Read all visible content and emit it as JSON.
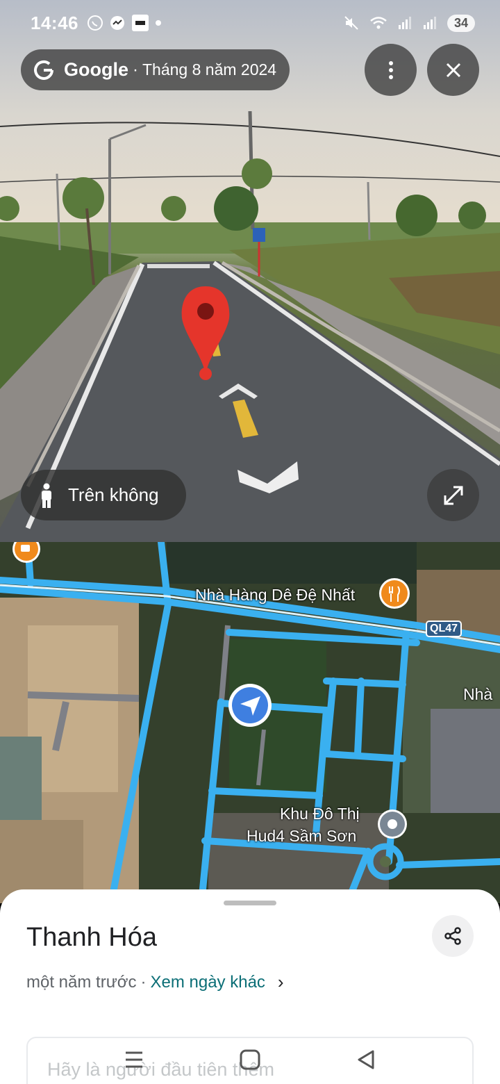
{
  "status_bar": {
    "time": "14:46",
    "battery": "34"
  },
  "street_view": {
    "brand": "Google",
    "date": "Tháng 8 năm 2024",
    "aerial_label": "Trên không",
    "separator": "·"
  },
  "map": {
    "poi_restaurant": "Nhà Hàng Dê Đệ Nhất",
    "route_shield": "QL47",
    "label_partial": "Nhà",
    "area_line1": "Khu Đô Thị",
    "area_line2": "Hud4 Sầm Sơn",
    "colors": {
      "road": "#3ab0f0",
      "accent": "#f08a1c"
    }
  },
  "sheet": {
    "title": "Thanh Hóa",
    "time_ago": "một năm trước",
    "separator": "·",
    "see_other_dates": "Xem ngày khác",
    "chevron": "›",
    "hint": "Hãy là người đầu tiên thêm"
  },
  "icons": [
    "more-vert-icon",
    "close-icon",
    "person-icon",
    "fullscreen-icon",
    "share-icon",
    "recents-icon",
    "home-icon",
    "back-icon"
  ]
}
